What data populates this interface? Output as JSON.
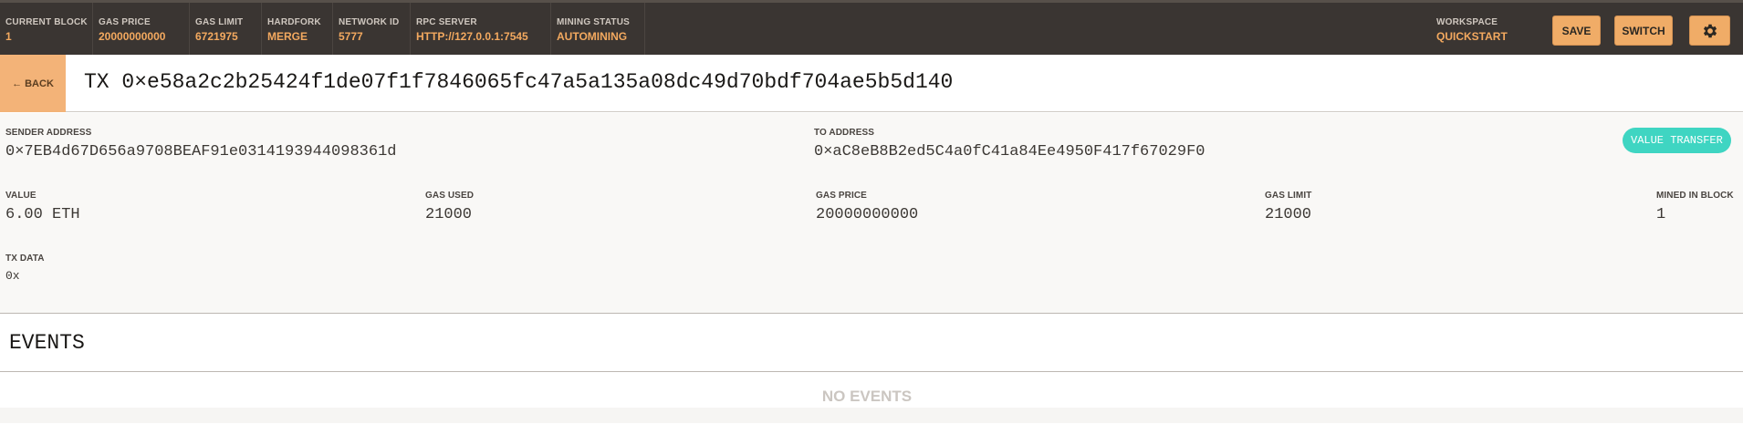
{
  "topbar": {
    "stats": [
      {
        "label": "CURRENT BLOCK",
        "value": "1"
      },
      {
        "label": "GAS PRICE",
        "value": "20000000000"
      },
      {
        "label": "GAS LIMIT",
        "value": "6721975"
      },
      {
        "label": "HARDFORK",
        "value": "MERGE"
      },
      {
        "label": "NETWORK ID",
        "value": "5777"
      },
      {
        "label": "RPC SERVER",
        "value": "HTTP://127.0.0.1:7545"
      },
      {
        "label": "MINING STATUS",
        "value": "AUTOMINING"
      }
    ],
    "workspace_label": "WORKSPACE",
    "workspace_value": "QUICKSTART",
    "save_label": "SAVE",
    "switch_label": "SWITCH",
    "settings_icon": "gear-icon"
  },
  "tx": {
    "back_label": "BACK",
    "back_icon": "left-arrow-icon",
    "title": "TX 0×e58a2c2b25424f1de07f1f7846065fc47a5a135a08dc49d70bdf704ae5b5d140",
    "sender_label": "SENDER ADDRESS",
    "sender": "0×7EB4d67D656a9708BEAF91e0314193944098361d",
    "to_label": "TO ADDRESS",
    "to": "0×aC8eB8B2ed5C4a0fC41a84Ee4950F417f67029F0",
    "badge": "VALUE TRANSFER",
    "badge_color": "#3fd5c2",
    "value_label": "VALUE",
    "value": "6.00 ETH",
    "gas_used_label": "GAS USED",
    "gas_used": "21000",
    "gas_price_label": "GAS PRICE",
    "gas_price": "20000000000",
    "gas_limit_label": "GAS LIMIT",
    "gas_limit": "21000",
    "mined_label": "MINED IN BLOCK",
    "mined": "1",
    "data_label": "TX DATA",
    "data": "0x"
  },
  "events": {
    "title": "EVENTS",
    "empty": "NO EVENTS"
  },
  "colors": {
    "topbar_bg": "#3a3532",
    "accent": "#f0ac67",
    "value_text": "#f3a95f"
  }
}
